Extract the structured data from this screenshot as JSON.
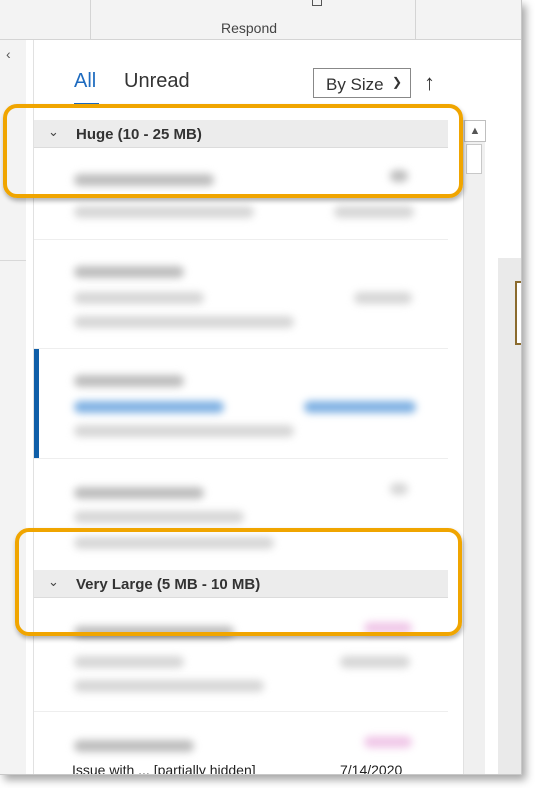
{
  "ribbon": {
    "group_label": "Respond"
  },
  "tabs": {
    "all": "All",
    "unread": "Unread"
  },
  "sort": {
    "field": "By Size",
    "direction_icon": "arrow-up-icon"
  },
  "groups": [
    {
      "label": "Huge (10 - 25 MB)"
    },
    {
      "label": "Very Large (5 MB - 10 MB)"
    }
  ],
  "bottom": {
    "text": "Issue with ... [partially hidden]",
    "date": "7/14/2020"
  },
  "colors": {
    "accent": "#1e6bbf",
    "highlight": "#f0a500",
    "selection": "#0f5ea8"
  }
}
